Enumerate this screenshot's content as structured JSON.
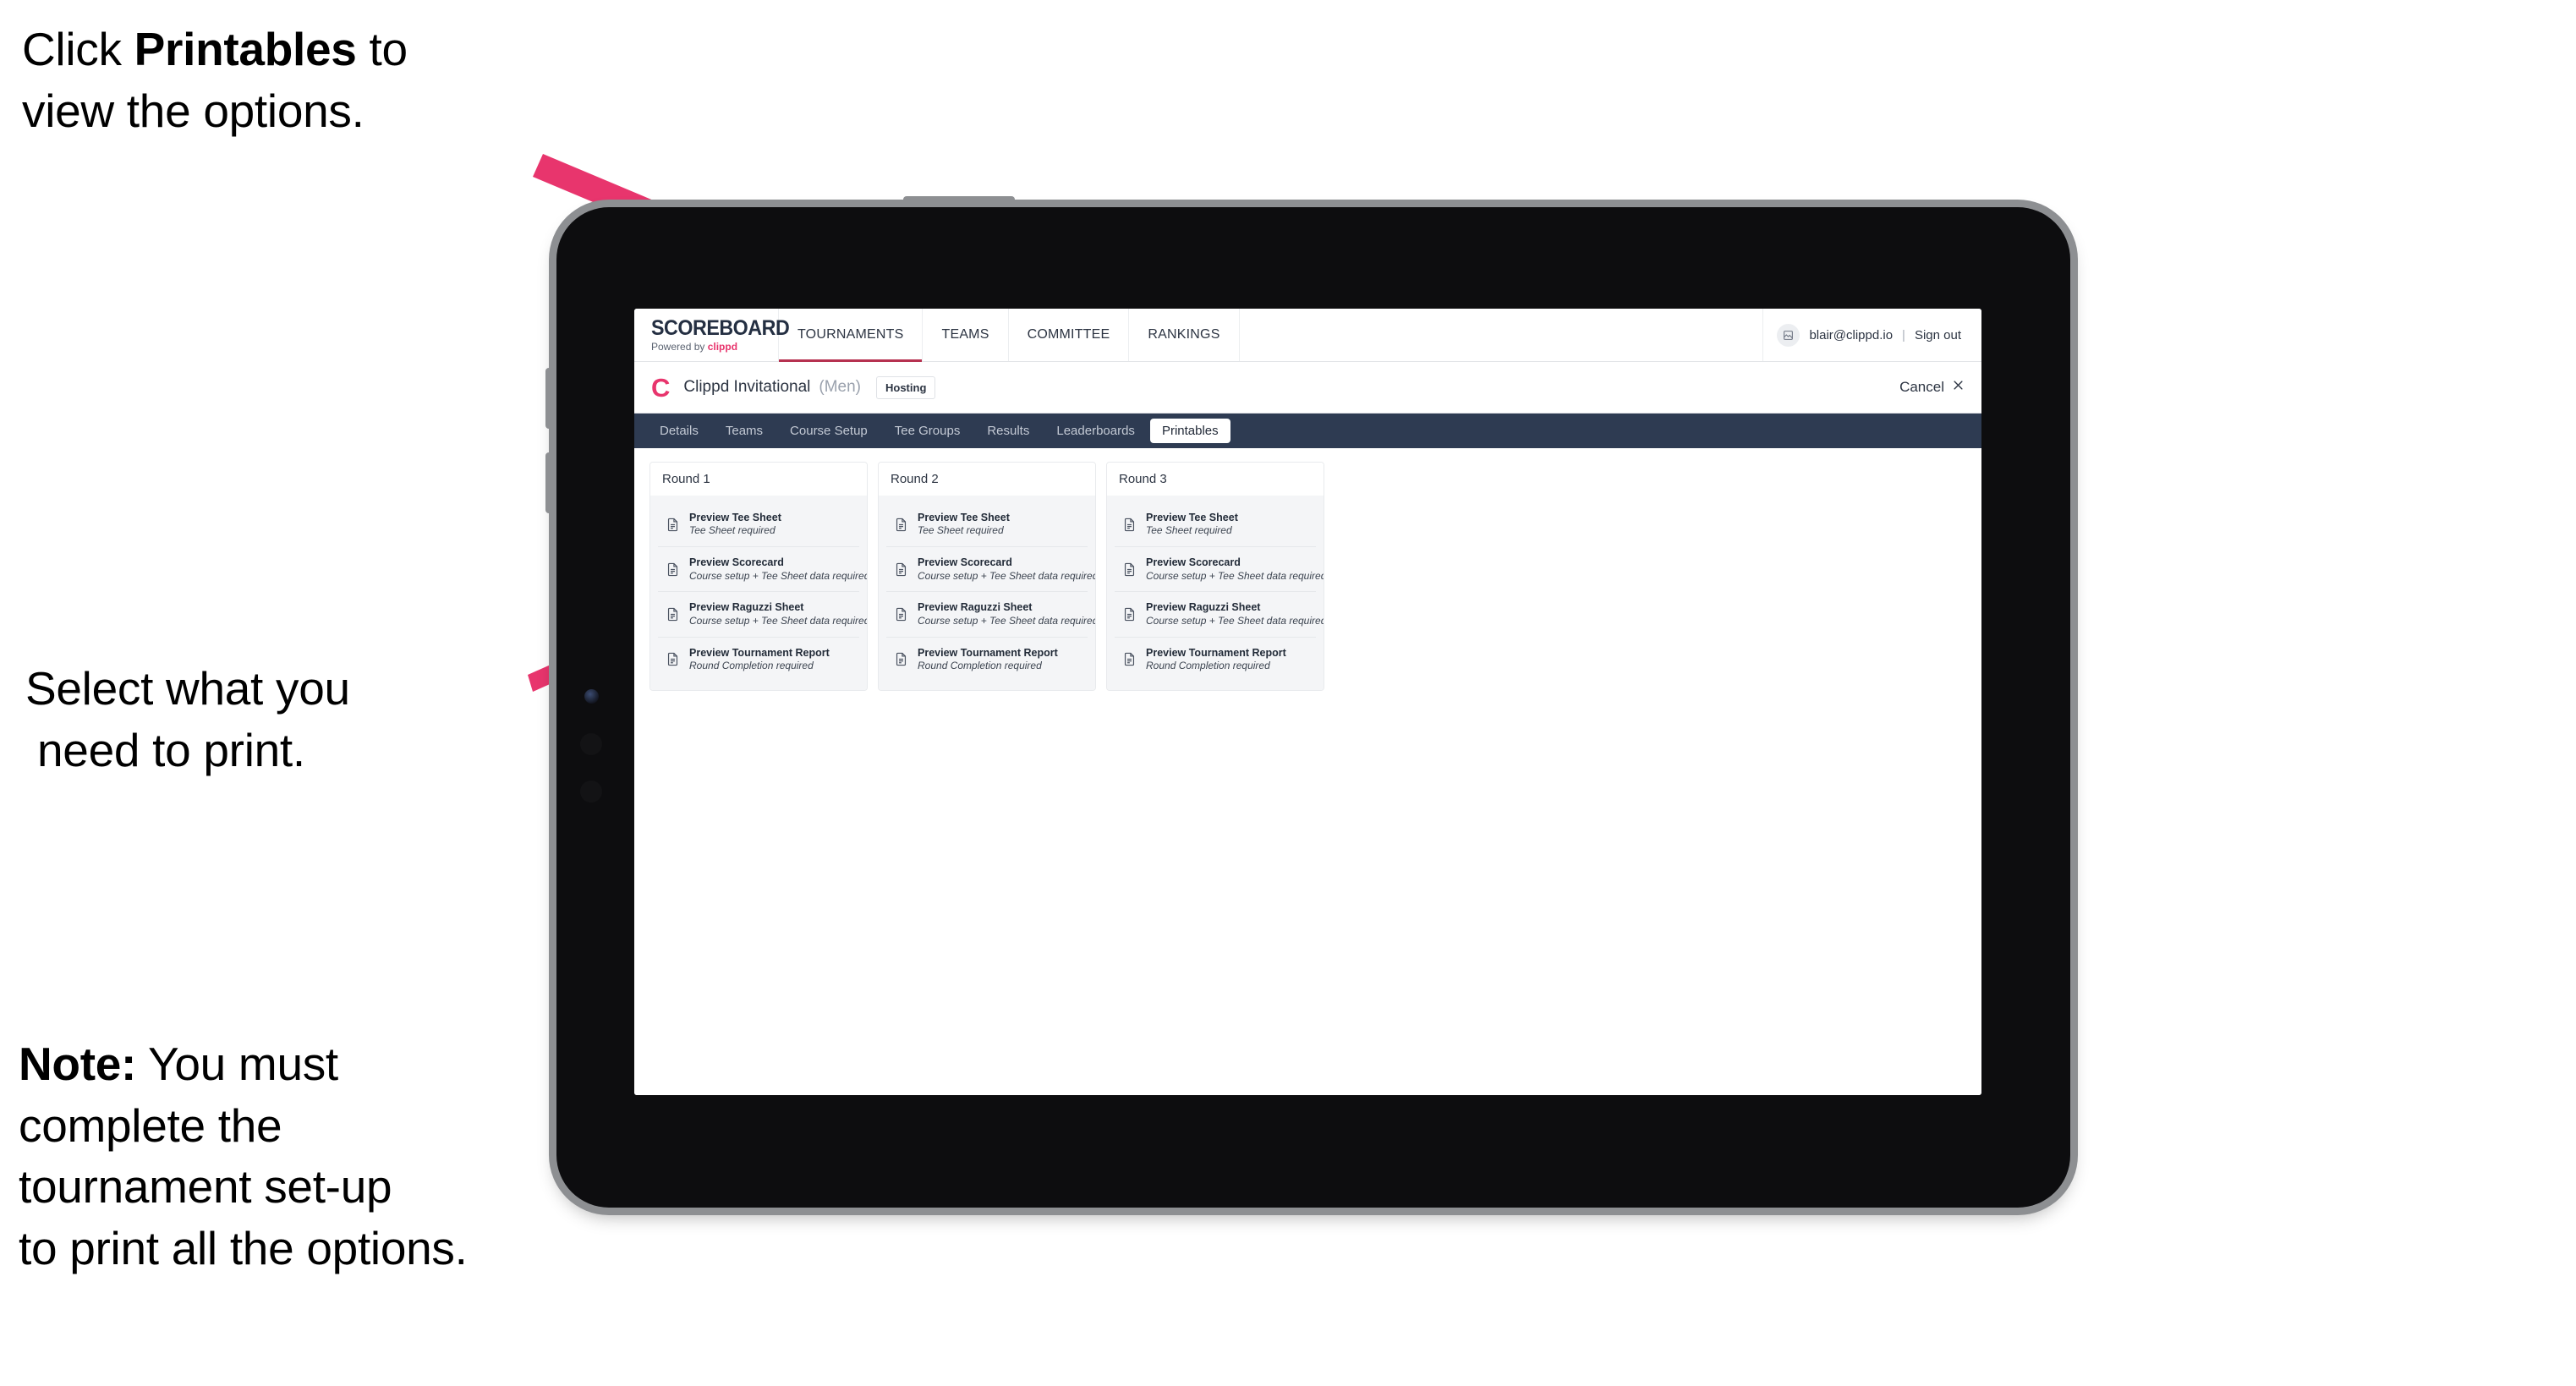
{
  "annotations": {
    "top": {
      "pre": "Click ",
      "bold": "Printables",
      "post": " to\nview the options."
    },
    "middle": {
      "line1": "Select what you",
      "line2": " need to print."
    },
    "note": {
      "bold": "Note:",
      "text": " You must\ncomplete the\ntournament set-up\nto print all the options."
    },
    "arrow_color": "#e8356d"
  },
  "app": {
    "topnav": {
      "brand_title": "SCOREBOARD",
      "brand_sub_prefix": "Powered by ",
      "brand_sub_name": "clippd",
      "items": [
        {
          "label": "TOURNAMENTS",
          "active": true
        },
        {
          "label": "TEAMS",
          "active": false
        },
        {
          "label": "COMMITTEE",
          "active": false
        },
        {
          "label": "RANKINGS",
          "active": false
        }
      ],
      "user_email": "blair@clippd.io",
      "separator": "|",
      "sign_out": "Sign out",
      "avatar_icon": "user-avatar-icon"
    },
    "subheader": {
      "logo_mark": "C",
      "tournament_name": "Clippd Invitational",
      "gender": "(Men)",
      "badge": "Hosting",
      "cancel_label": "Cancel",
      "cancel_icon": "close-icon"
    },
    "tabs": [
      {
        "label": "Details",
        "active": false
      },
      {
        "label": "Teams",
        "active": false
      },
      {
        "label": "Course Setup",
        "active": false
      },
      {
        "label": "Tee Groups",
        "active": false
      },
      {
        "label": "Results",
        "active": false
      },
      {
        "label": "Leaderboards",
        "active": false
      },
      {
        "label": "Printables",
        "active": true
      }
    ],
    "rounds": [
      {
        "title": "Round 1",
        "items": [
          {
            "title": "Preview Tee Sheet",
            "sub": "Tee Sheet required",
            "icon": "document-icon"
          },
          {
            "title": "Preview Scorecard",
            "sub": "Course setup + Tee Sheet data required",
            "icon": "document-icon"
          },
          {
            "title": "Preview Raguzzi Sheet",
            "sub": "Course setup + Tee Sheet data required",
            "icon": "document-icon"
          },
          {
            "title": "Preview Tournament Report",
            "sub": "Round Completion required",
            "icon": "document-icon"
          }
        ]
      },
      {
        "title": "Round 2",
        "items": [
          {
            "title": "Preview Tee Sheet",
            "sub": "Tee Sheet required",
            "icon": "document-icon"
          },
          {
            "title": "Preview Scorecard",
            "sub": "Course setup + Tee Sheet data required",
            "icon": "document-icon"
          },
          {
            "title": "Preview Raguzzi Sheet",
            "sub": "Course setup + Tee Sheet data required",
            "icon": "document-icon"
          },
          {
            "title": "Preview Tournament Report",
            "sub": "Round Completion required",
            "icon": "document-icon"
          }
        ]
      },
      {
        "title": "Round 3",
        "items": [
          {
            "title": "Preview Tee Sheet",
            "sub": "Tee Sheet required",
            "icon": "document-icon"
          },
          {
            "title": "Preview Scorecard",
            "sub": "Course setup + Tee Sheet data required",
            "icon": "document-icon"
          },
          {
            "title": "Preview Raguzzi Sheet",
            "sub": "Course setup + Tee Sheet data required",
            "icon": "document-icon"
          },
          {
            "title": "Preview Tournament Report",
            "sub": "Round Completion required",
            "icon": "document-icon"
          }
        ]
      }
    ],
    "colors": {
      "tabbar": "#2e3b52",
      "accent_pink": "#e8356d",
      "active_underline": "#b63150"
    }
  }
}
